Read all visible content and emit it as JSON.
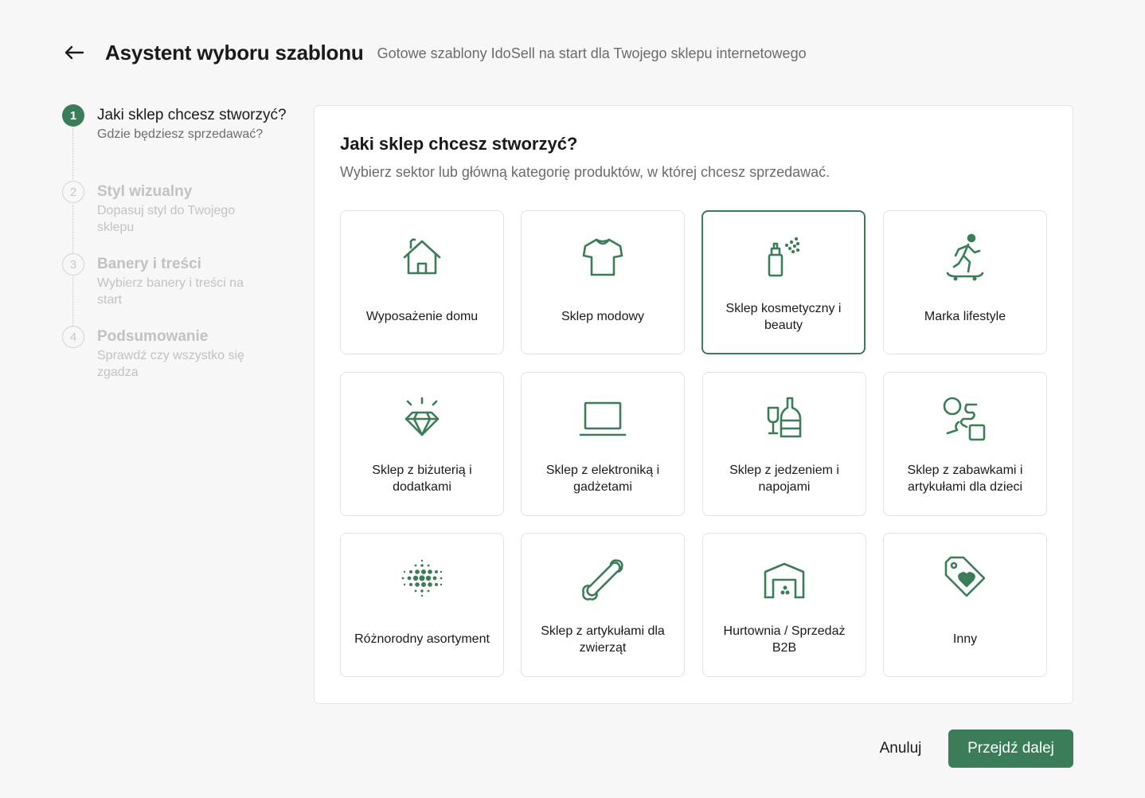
{
  "header": {
    "title": "Asystent wyboru szablonu",
    "subtitle": "Gotowe szablony IdoSell na start dla Twojego sklepu internetowego",
    "back_icon": "arrow-left-icon"
  },
  "steps": [
    {
      "number": "1",
      "title": "Jaki sklep chcesz stworzyć?",
      "description": "Gdzie będziesz sprzedawać?",
      "state": "active"
    },
    {
      "number": "2",
      "title": "Styl wizualny",
      "description": "Dopasuj styl do Twojego sklepu",
      "state": "inactive"
    },
    {
      "number": "3",
      "title": "Banery i treści",
      "description": "Wybierz banery i treści na start",
      "state": "inactive"
    },
    {
      "number": "4",
      "title": "Podsumowanie",
      "description": "Sprawdź czy wszystko się zgadza",
      "state": "inactive"
    }
  ],
  "panel": {
    "title": "Jaki sklep chcesz stworzyć?",
    "description": "Wybierz sektor lub główną kategorię produktów, w której chcesz sprzedawać."
  },
  "options": [
    {
      "label": "Wyposażenie domu",
      "icon": "house-icon",
      "selected": false
    },
    {
      "label": "Sklep modowy",
      "icon": "tshirt-icon",
      "selected": false
    },
    {
      "label": "Sklep kosmetyczny i beauty",
      "icon": "spray-bottle-icon",
      "selected": true
    },
    {
      "label": "Marka lifestyle",
      "icon": "skateboarder-icon",
      "selected": false
    },
    {
      "label": "Sklep z biżuterią i dodatkami",
      "icon": "diamond-icon",
      "selected": false
    },
    {
      "label": "Sklep z elektroniką i gadżetami",
      "icon": "laptop-icon",
      "selected": false
    },
    {
      "label": "Sklep z jedzeniem i napojami",
      "icon": "wine-bottle-icon",
      "selected": false
    },
    {
      "label": "Sklep z zabawkami i artykułami dla dzieci",
      "icon": "toy-shapes-icon",
      "selected": false
    },
    {
      "label": "Różnorodny asortyment",
      "icon": "dots-pattern-icon",
      "selected": false
    },
    {
      "label": "Sklep z artykułami dla zwierząt",
      "icon": "bone-icon",
      "selected": false
    },
    {
      "label": "Hurtownia / Sprzedaż B2B",
      "icon": "warehouse-icon",
      "selected": false
    },
    {
      "label": "Inny",
      "icon": "tag-heart-icon",
      "selected": false
    }
  ],
  "footer": {
    "cancel_label": "Anuluj",
    "next_label": "Przejdź dalej"
  },
  "colors": {
    "accent": "#3a7d58",
    "background": "#f7f7f7",
    "muted_text": "#6b6b6b",
    "disabled_text": "#c2c2c2"
  }
}
